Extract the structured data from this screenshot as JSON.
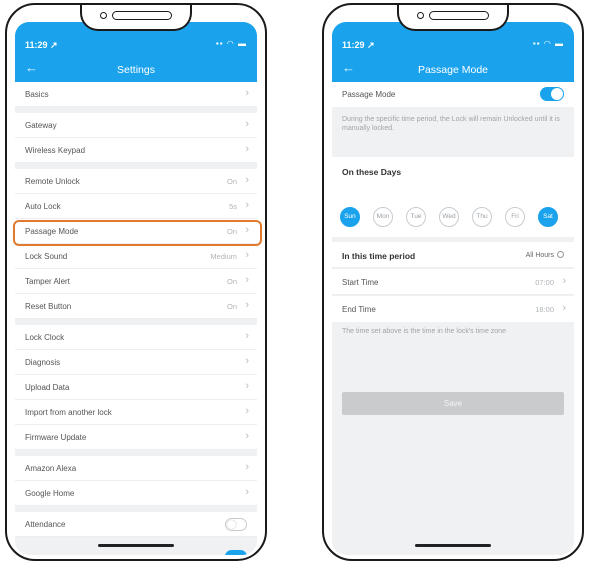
{
  "left": {
    "status_time": "11:29 ↗",
    "status_icons": "▪▪ ◠ ▬",
    "title": "Settings",
    "sections": [
      [
        {
          "label": "Basics",
          "value": ""
        }
      ],
      [
        {
          "label": "Gateway",
          "value": ""
        },
        {
          "label": "Wireless Keypad",
          "value": ""
        }
      ],
      [
        {
          "label": "Remote Unlock",
          "value": "On"
        },
        {
          "label": "Auto Lock",
          "value": "5s"
        },
        {
          "label": "Passage Mode",
          "value": "On"
        },
        {
          "label": "Lock Sound",
          "value": "Medium"
        },
        {
          "label": "Tamper Alert",
          "value": "On"
        },
        {
          "label": "Reset Button",
          "value": "On"
        }
      ],
      [
        {
          "label": "Lock Clock",
          "value": ""
        },
        {
          "label": "Diagnosis",
          "value": ""
        },
        {
          "label": "Upload Data",
          "value": ""
        },
        {
          "label": "Import from another lock",
          "value": ""
        },
        {
          "label": "Firmware Update",
          "value": ""
        }
      ],
      [
        {
          "label": "Amazon Alexa",
          "value": ""
        },
        {
          "label": "Google Home",
          "value": ""
        }
      ]
    ],
    "attendance_label": "Attendance"
  },
  "right": {
    "status_time": "11:29 ↗",
    "status_icons": "▪▪ ◠ ▬",
    "title": "Passage Mode",
    "passage_label": "Passage Mode",
    "description": "During the specific time period, the Lock will remain Unlocked until it is manually locked.",
    "days_heading": "On these Days",
    "days": [
      {
        "label": "Sun",
        "on": true
      },
      {
        "label": "Mon",
        "on": false
      },
      {
        "label": "Tue",
        "on": false
      },
      {
        "label": "Wed",
        "on": false
      },
      {
        "label": "Thu",
        "on": false
      },
      {
        "label": "Fri",
        "on": false
      },
      {
        "label": "Sat",
        "on": true
      }
    ],
    "period_heading": "In this time period",
    "all_hours_label": "All Hours",
    "start_label": "Start Time",
    "start_value": "07:00",
    "end_label": "End Time",
    "end_value": "18:00",
    "note": "The time set above is the time in the lock's time zone",
    "save_label": "Save"
  },
  "colors": {
    "accent": "#1aa3ec",
    "highlight": "#e07a2f"
  }
}
